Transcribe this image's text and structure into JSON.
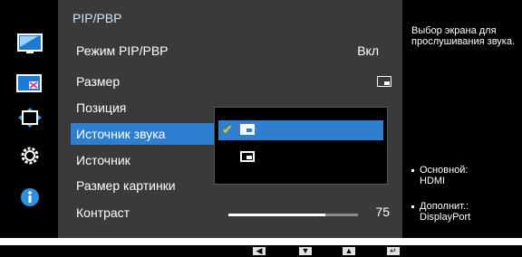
{
  "menu": {
    "title": "PIP/PBP",
    "items": [
      {
        "label": "Режим PIP/PBP",
        "value": "Вкл"
      },
      {
        "label": "Размер"
      },
      {
        "label": "Позиция"
      },
      {
        "label": "Источник звука"
      },
      {
        "label": "Источник"
      },
      {
        "label": "Размер картинки"
      },
      {
        "label": "Контраст",
        "value": "75"
      }
    ],
    "contrast_level_percent": 75
  },
  "left_icons": [
    "picture-icon",
    "pip-pbp-icon",
    "position-icon",
    "system-settings-icon",
    "information-icon"
  ],
  "dropdown": {
    "selected_index": 0,
    "options": [
      {
        "icon": "main-screen-icon",
        "selected": true
      },
      {
        "icon": "sub-screen-icon",
        "selected": false
      }
    ]
  },
  "help": {
    "text": "Выбор экрана для прослушивания звука."
  },
  "info": {
    "main_label": "Основной:",
    "main_value": "HDMI",
    "sub_label": "Дополнит.:",
    "sub_value": "DisplayPort"
  },
  "nav": [
    "left-button",
    "down-button",
    "up-button",
    "enter-button"
  ],
  "colors": {
    "highlight": "#2f7fd1",
    "panel_bg": "#3a3a3a",
    "check": "#f2c800"
  }
}
